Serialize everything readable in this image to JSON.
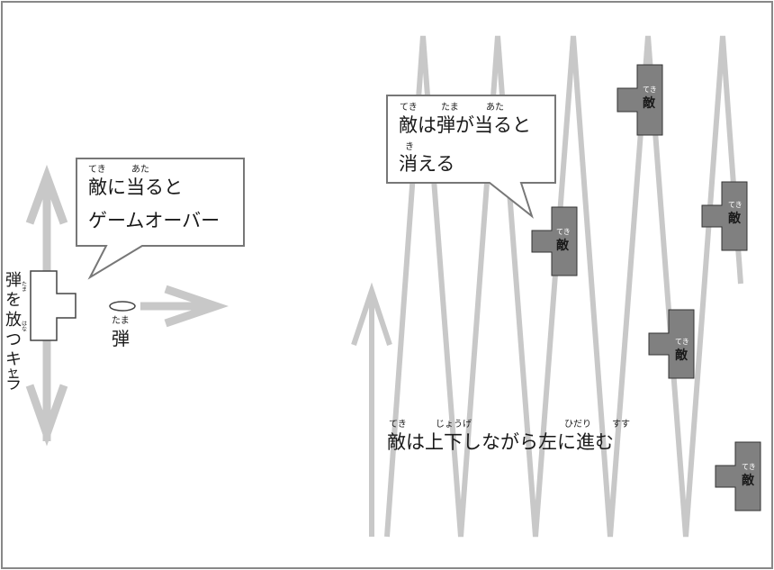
{
  "player": {
    "label_lines": [
      "弾",
      "を",
      "放",
      "つ",
      "キ",
      "ャ",
      "ラ"
    ],
    "ruby_tama": "たま",
    "ruby_hana": "はな"
  },
  "bullet": {
    "label": "弾",
    "ruby": "たま"
  },
  "bubble_left": {
    "line1": "敵に当ると",
    "line2": "ゲームオーバー",
    "ruby_teki": "てき",
    "ruby_ata": "あた"
  },
  "bubble_right": {
    "line1": "敵は弾が当ると",
    "line2": "消える",
    "ruby_teki": "てき",
    "ruby_tama": "たま",
    "ruby_ata": "あた",
    "ruby_ki": "き"
  },
  "enemy": {
    "label": "敵",
    "ruby": "てき"
  },
  "caption": {
    "text": "敵は上下しながら左に進む",
    "ruby_teki": "てき",
    "ruby_jouge": "じょうげ",
    "ruby_hidari": "ひだり",
    "ruby_susu": "すす"
  },
  "colors": {
    "frame": "#888888",
    "arrow": "#c8c8c8",
    "enemy_fill": "#808080",
    "ink": "#1a1a1a"
  }
}
